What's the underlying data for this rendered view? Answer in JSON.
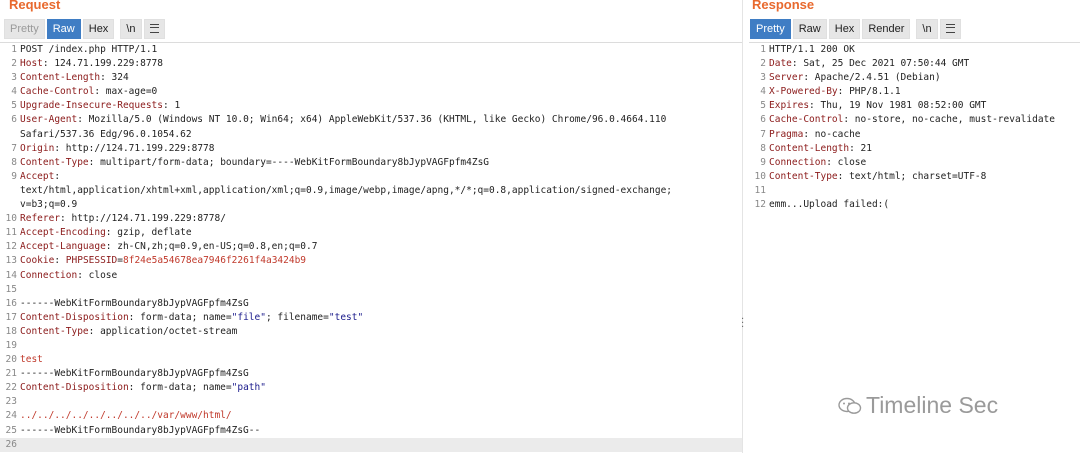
{
  "request": {
    "title": "Request",
    "toolbar": [
      "Pretty",
      "Raw",
      "Hex",
      "\\n"
    ],
    "lines": [
      {
        "n": "1",
        "parts": [
          [
            "POST /index.php HTTP/1.1",
            ""
          ]
        ]
      },
      {
        "n": "2",
        "parts": [
          [
            "Host",
            ""
          ],
          [
            ": 124.71.199.229:8778",
            ""
          ]
        ]
      },
      {
        "n": "3",
        "parts": [
          [
            "Content-Length",
            ""
          ],
          [
            ": 324",
            ""
          ]
        ]
      },
      {
        "n": "4",
        "parts": [
          [
            "Cache-Control",
            ""
          ],
          [
            ": max-age=0",
            ""
          ]
        ]
      },
      {
        "n": "5",
        "parts": [
          [
            "Upgrade-Insecure-Requests",
            ""
          ],
          [
            ": 1",
            ""
          ]
        ]
      },
      {
        "n": "6",
        "parts": [
          [
            "User-Agent",
            ""
          ],
          [
            ": Mozilla/5.0 (Windows NT 10.0; Win64; x64) AppleWebKit/537.36 (KHTML, like Gecko) Chrome/96.0.4664.110",
            ""
          ]
        ]
      },
      {
        "n": "",
        "parts": [
          [
            "Safari/537.36 Edg/96.0.1054.62",
            ""
          ]
        ]
      },
      {
        "n": "7",
        "parts": [
          [
            "Origin",
            ""
          ],
          [
            ": http://124.71.199.229:8778",
            ""
          ]
        ]
      },
      {
        "n": "8",
        "parts": [
          [
            "Content-Type",
            ""
          ],
          [
            ": multipart/form-data; boundary=----WebKitFormBoundary8bJypVAGFpfm4ZsG",
            ""
          ]
        ]
      },
      {
        "n": "9",
        "parts": [
          [
            "Accept",
            ""
          ],
          [
            ":",
            ""
          ]
        ]
      },
      {
        "n": "",
        "parts": [
          [
            "text/html,application/xhtml+xml,application/xml;q=0.9,image/webp,image/apng,*/*;q=0.8,application/signed-exchange;",
            ""
          ]
        ]
      },
      {
        "n": "",
        "parts": [
          [
            "v=b3;q=0.9",
            ""
          ]
        ]
      },
      {
        "n": "10",
        "parts": [
          [
            "Referer",
            ""
          ],
          [
            ": http://124.71.199.229:8778/",
            ""
          ]
        ]
      },
      {
        "n": "11",
        "parts": [
          [
            "Accept-Encoding",
            ""
          ],
          [
            ": gzip, deflate",
            ""
          ]
        ]
      },
      {
        "n": "12",
        "parts": [
          [
            "Accept-Language",
            ""
          ],
          [
            ": zh-CN,zh;q=0.9,en-US;q=0.8,en;q=0.7",
            ""
          ]
        ]
      },
      {
        "n": "13",
        "parts": [
          [
            "Cookie",
            ""
          ],
          [
            ": ",
            ""
          ],
          [
            "PHPSESSID",
            ""
          ],
          [
            "=",
            ""
          ],
          [
            "8f24e5a54678ea7946f2261f4a3424b9",
            ""
          ]
        ]
      },
      {
        "n": "14",
        "parts": [
          [
            "Connection",
            ""
          ],
          [
            ": close",
            ""
          ]
        ]
      },
      {
        "n": "15",
        "parts": [
          [
            "",
            ""
          ]
        ]
      },
      {
        "n": "16",
        "parts": [
          [
            "------WebKitFormBoundary8bJypVAGFpfm4ZsG",
            ""
          ]
        ]
      },
      {
        "n": "17",
        "parts": [
          [
            "Content-Disposition",
            ""
          ],
          [
            ": form-data; name=",
            ""
          ],
          [
            "\"file\"",
            ""
          ],
          [
            "; filename=",
            ""
          ],
          [
            "\"test\"",
            ""
          ]
        ]
      },
      {
        "n": "18",
        "parts": [
          [
            "Content-Type",
            ""
          ],
          [
            ": application/octet-stream",
            ""
          ]
        ]
      },
      {
        "n": "19",
        "parts": [
          [
            "",
            ""
          ]
        ]
      },
      {
        "n": "20",
        "parts": [
          [
            "test",
            ""
          ]
        ]
      },
      {
        "n": "21",
        "parts": [
          [
            "------WebKitFormBoundary8bJypVAGFpfm4ZsG",
            ""
          ]
        ]
      },
      {
        "n": "22",
        "parts": [
          [
            "Content-Disposition",
            ""
          ],
          [
            ": form-data; name=",
            ""
          ],
          [
            "\"path\"",
            ""
          ]
        ]
      },
      {
        "n": "23",
        "parts": [
          [
            "",
            ""
          ]
        ]
      },
      {
        "n": "24",
        "parts": [
          [
            "../../../../../../../../var/www/html/",
            ""
          ]
        ]
      },
      {
        "n": "25",
        "parts": [
          [
            "------WebKitFormBoundary8bJypVAGFpfm4ZsG--",
            ""
          ]
        ]
      },
      {
        "n": "26",
        "parts": [
          [
            "",
            ""
          ]
        ]
      }
    ]
  },
  "response": {
    "title": "Response",
    "toolbar": [
      "Pretty",
      "Raw",
      "Hex",
      "Render",
      "\\n"
    ],
    "lines": [
      {
        "n": "1",
        "parts": [
          [
            "HTTP/1.1 200 OK",
            ""
          ]
        ]
      },
      {
        "n": "2",
        "parts": [
          [
            "Date",
            ""
          ],
          [
            ": Sat, 25 Dec 2021 07:50:44 GMT",
            ""
          ]
        ]
      },
      {
        "n": "3",
        "parts": [
          [
            "Server",
            ""
          ],
          [
            ": Apache/2.4.51 (Debian)",
            ""
          ]
        ]
      },
      {
        "n": "4",
        "parts": [
          [
            "X-Powered-By",
            ""
          ],
          [
            ": PHP/8.1.1",
            ""
          ]
        ]
      },
      {
        "n": "5",
        "parts": [
          [
            "Expires",
            ""
          ],
          [
            ": Thu, 19 Nov 1981 08:52:00 GMT",
            ""
          ]
        ]
      },
      {
        "n": "6",
        "parts": [
          [
            "Cache-Control",
            ""
          ],
          [
            ": no-store, no-cache, must-revalidate",
            ""
          ]
        ]
      },
      {
        "n": "7",
        "parts": [
          [
            "Pragma",
            ""
          ],
          [
            ": no-cache",
            ""
          ]
        ]
      },
      {
        "n": "8",
        "parts": [
          [
            "Content-Length",
            ""
          ],
          [
            ": 21",
            ""
          ]
        ]
      },
      {
        "n": "9",
        "parts": [
          [
            "Connection",
            ""
          ],
          [
            ": close",
            ""
          ]
        ]
      },
      {
        "n": "10",
        "parts": [
          [
            "Content-Type",
            ""
          ],
          [
            ": text/html; charset=UTF-8",
            ""
          ]
        ]
      },
      {
        "n": "11",
        "parts": [
          [
            "",
            ""
          ]
        ]
      },
      {
        "n": "12",
        "parts": [
          [
            "emm...Upload failed:(",
            ""
          ]
        ]
      }
    ]
  },
  "watermark": "Timeline Sec",
  "colors": {
    "accent": "#e8692e",
    "active_tab": "#3f7dc4",
    "header_key": "#8b1a1a",
    "string": "#1a1a8b",
    "value": "#c0392b"
  }
}
